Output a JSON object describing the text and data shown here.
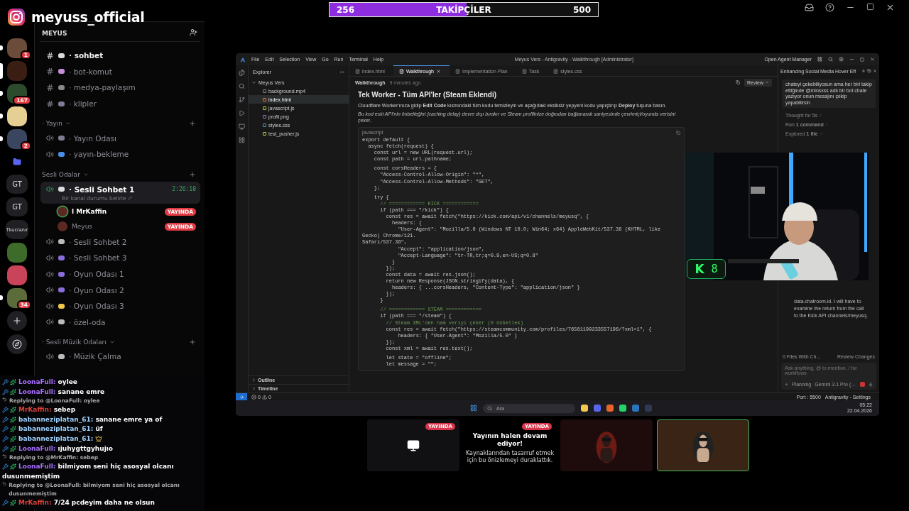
{
  "channel_banner": {
    "handle": "meyuss_official"
  },
  "follower_goal": {
    "current": "256",
    "label": "TAKİPÇİLER",
    "target": "500",
    "level": 0.51
  },
  "discord": {
    "server": "MEYUS",
    "servers": [
      {
        "kind": "picture",
        "selected": false,
        "unread": true,
        "badge": "1"
      },
      {
        "kind": "picture",
        "selected": true
      },
      {
        "kind": "picture",
        "selected": false,
        "unread": true,
        "badge": "167"
      },
      {
        "kind": "picture",
        "selected": false,
        "unread": true
      },
      {
        "kind": "picture",
        "selected": false,
        "unread": true,
        "badge": "2"
      },
      {
        "kind": "folder",
        "selected": false,
        "unread": false
      },
      {
        "kind": "label",
        "label": "GT",
        "selected": false,
        "unread": false
      },
      {
        "kind": "label",
        "label": "GT",
        "selected": false,
        "unread": false
      },
      {
        "kind": "label",
        "label": "Tkucranır",
        "selected": false,
        "unread": false
      },
      {
        "kind": "picture",
        "selected": false,
        "unread": false
      },
      {
        "kind": "picture",
        "selected": false,
        "unread": false
      },
      {
        "kind": "picture",
        "selected": false,
        "unread": true,
        "badge": "34"
      }
    ],
    "channels": [
      {
        "kind": "text",
        "name": "· sohbet",
        "unread": true
      },
      {
        "kind": "text",
        "name": "· bot-komut",
        "unread": false
      },
      {
        "kind": "text",
        "name": "· medya-paylaşım",
        "unread": false
      },
      {
        "kind": "text",
        "name": "· klipler",
        "unread": false
      },
      {
        "kind": "category",
        "name": "· Yayın"
      },
      {
        "kind": "voice",
        "name": "· Yayın Odası",
        "selected": false
      },
      {
        "kind": "voice",
        "name": "· yayın-bekleme",
        "selected": false
      },
      {
        "kind": "category",
        "name": "Sesli Odalar"
      },
      {
        "kind": "voice",
        "name": "· Sesli Sohbet 1",
        "selected": true,
        "timer": "2:26:10",
        "status": "Bir kanal durumu belirle"
      },
      {
        "kind": "user",
        "name": "l MrKaffin",
        "badge": "YAYINDA",
        "speaking": true
      },
      {
        "kind": "user",
        "name": "Meyus",
        "badge": "YAYINDA",
        "speaking": false
      },
      {
        "kind": "voice",
        "name": "· Sesli Sohbet 2",
        "selected": false
      },
      {
        "kind": "voice",
        "name": "· Sesli Sohbet 3",
        "selected": false
      },
      {
        "kind": "voice",
        "name": "· Oyun Odası 1",
        "selected": false
      },
      {
        "kind": "voice",
        "name": "· Oyun Odası 2",
        "selected": false
      },
      {
        "kind": "voice",
        "name": "· Oyun Odası 3",
        "selected": false
      },
      {
        "kind": "voice",
        "name": "· özel-oda",
        "selected": false
      },
      {
        "kind": "category",
        "name": "· Sesli Müzik Odaları"
      },
      {
        "kind": "voice",
        "name": "· Müzik Çalma",
        "selected": false
      }
    ]
  },
  "chat": [
    {
      "kind": "message",
      "user": "LoonaFull:",
      "color": "#a970ff",
      "text": "oylee"
    },
    {
      "kind": "message",
      "user": "LoonaFull:",
      "color": "#a970ff",
      "text": "sanane emre"
    },
    {
      "kind": "reply",
      "text": "Replying to @LoonaFull: oylee"
    },
    {
      "kind": "message",
      "user": "MrKaffin:",
      "color": "#e0403a",
      "text": "sebep"
    },
    {
      "kind": "message",
      "user": "babanneziplatan_61:",
      "color": "#9fd3ff",
      "text": "sanane emre ya of"
    },
    {
      "kind": "message",
      "user": "babanneziplatan_61:",
      "color": "#9fd3ff",
      "text": "üf"
    },
    {
      "kind": "emote",
      "user": "babanneziplatan_61:",
      "color": "#9fd3ff"
    },
    {
      "kind": "message",
      "user": "LoonaFull:",
      "color": "#a970ff",
      "text": "ıjuhygttgyhujıo"
    },
    {
      "kind": "reply",
      "text": "Replying to @MrKaffin: sebep"
    },
    {
      "kind": "message",
      "user": "LoonaFull:",
      "color": "#a970ff",
      "text": "bilmiyom seni hiç asosyal olcanı dusunmemiştim"
    },
    {
      "kind": "reply",
      "text": "Replying to @LoonaFull: bilmiyom seni hiç asosyal olcanı dusunmemiştim"
    },
    {
      "kind": "message",
      "user": "MrKaffin:",
      "color": "#e0403a",
      "text": "7/24 pcdeyim daha ne olsun"
    }
  ],
  "ide": {
    "menu": [
      "File",
      "Edit",
      "Selection",
      "View",
      "Go",
      "Run",
      "Terminal",
      "Help"
    ],
    "title": "Meyus Vers - Antigravity - Walkthrough [Administrator]",
    "agent_manager": "Open Agent Manager",
    "explorer": {
      "title": "Explorer",
      "folder": "Meyus Vers",
      "files": [
        {
          "name": "background.mp4",
          "selected": false
        },
        {
          "name": "index.html",
          "selected": true
        },
        {
          "name": "javascript.js",
          "selected": false
        },
        {
          "name": "profil.png",
          "selected": false
        },
        {
          "name": "styles.css",
          "selected": false
        },
        {
          "name": "test_pusher.js",
          "selected": false
        }
      ],
      "sections": [
        "Outline",
        "Timeline"
      ]
    },
    "tabs": [
      {
        "label": "index.html",
        "selected": false
      },
      {
        "label": "Walkthrough",
        "selected": true
      },
      {
        "label": "Implementation Plan",
        "selected": false
      },
      {
        "label": "Task",
        "selected": false
      },
      {
        "label": "styles.css",
        "selected": false
      }
    ],
    "breadcrumb": "Walkthrough",
    "edited": "9 minutes ago",
    "review": "Review",
    "doc": {
      "heading": "Tek Worker - Tüm API'ler (Steam Eklendi)",
      "paragraph": "Cloudflare Worker'ınıza gidip **Edit Code** kısmındaki tüm kodu temizleyin ve aşağıdaki eksiksiz yepyeni kodu yapıştırıp **Deploy** tuşuna basın.",
      "note": "Bu kod eski API'nin önbelleğini (caching delay) devre dışı bırakır ve Steam profilinize doğrudan bağlanarak saniyesinde çevrimiçi/oyunda verisini çeker.",
      "language": "javascript",
      "code": [
        {
          "kind": "code",
          "text": "export default {"
        },
        {
          "kind": "code",
          "text": "  async fetch(request) {"
        },
        {
          "kind": "code",
          "text": "    const url = new URL(request.url);"
        },
        {
          "kind": "code",
          "text": "    const path = url.pathname;"
        },
        {
          "kind": "code",
          "text": "    const corsHeaders = {",
          "space_before": true
        },
        {
          "kind": "code",
          "text": "      \"Access-Control-Allow-Origin\": \"*\","
        },
        {
          "kind": "code",
          "text": "      \"Access-Control-Allow-Methods\": \"GET\","
        },
        {
          "kind": "code",
          "text": "    };"
        },
        {
          "kind": "code",
          "text": "    try {",
          "space_before": true
        },
        {
          "kind": "comment",
          "text": "      // ============ KICK ============"
        },
        {
          "kind": "code",
          "text": "      if (path === \"/kick\") {"
        },
        {
          "kind": "code",
          "text": "        const res = await fetch(\"https://kick.com/api/v1/channels/meyusq\", {"
        },
        {
          "kind": "code",
          "text": "          headers: {"
        },
        {
          "kind": "code",
          "text": "            \"User-Agent\": \"Mozilla/5.0 (Windows NT 10.0; Win64; x64) AppleWebKit/537.36 (KHTML, like Gecko) Chrome/121."
        },
        {
          "kind": "code",
          "text": "Safari/537.36\","
        },
        {
          "kind": "code",
          "text": "            \"Accept\": \"application/json\","
        },
        {
          "kind": "code",
          "text": "            \"Accept-Language\": \"tr-TR,tr;q=0.9,en-US;q=0.8\""
        },
        {
          "kind": "code",
          "text": "          }"
        },
        {
          "kind": "code",
          "text": "        });"
        },
        {
          "kind": "code",
          "text": "        const data = await res.json();"
        },
        {
          "kind": "code",
          "text": "        return new Response(JSON.stringify(data), {"
        },
        {
          "kind": "code",
          "text": "          headers: { ...corsHeaders, \"Content-Type\": \"application/json\" }"
        },
        {
          "kind": "code",
          "text": "        });"
        },
        {
          "kind": "code",
          "text": "      }"
        },
        {
          "kind": "comment",
          "text": "      // ============ STEAM ============",
          "space_before": true
        },
        {
          "kind": "code",
          "text": "      if (path === \"/steam\") {"
        },
        {
          "kind": "comment",
          "text": "        // Steam XML'den ham veriyi çeker (0 önbellek)"
        },
        {
          "kind": "code",
          "text": "        const res = await fetch(\"https://steamcommunity.com/profiles/76561199233557196/?xml=1\", {"
        },
        {
          "kind": "code",
          "text": "            headers: { \"User-Agent\": \"Mozilla/5.0\" }"
        },
        {
          "kind": "code",
          "text": "        });"
        },
        {
          "kind": "code",
          "text": "        const xml = await res.text();"
        },
        {
          "kind": "code",
          "text": "        let state = \"offline\";",
          "space_before": true
        },
        {
          "kind": "code",
          "text": "        let message = \"\";"
        }
      ]
    },
    "agent": {
      "title": "Enhancing Social Media Hover Eff",
      "user_message": "chateyi çekebiliyosun ama her biri takip ettiğinde @minsxss adlı bir bot chate yazıyor onun mesajını çekip yapabilirsin",
      "steps": [
        "Thought for 5s",
        "Ran **1 command**",
        "Explored **1 file**"
      ],
      "reply": "data.chatroom.id. I will have to examine the return from the call to the Kick API channels/meyusq.",
      "files": "0 Files With Ch...",
      "review_changes": "Review Changes",
      "prompt": {
        "placeholder": "Ask anything, @ to mention, / for workflows"
      },
      "mode": "Planning",
      "model": "Gemini 3.1 Pro (..."
    },
    "status": {
      "errors": "0",
      "warnings": "0",
      "port": "Port : 5500",
      "settings": "Antigravity - Settings"
    },
    "taskbar": {
      "search": "Ara",
      "time": "05:22",
      "date": "22.04.2026"
    }
  },
  "webcam": {
    "kind": "picture",
    "logo": "K",
    "count": "8"
  },
  "previews": [
    {
      "kind": "screen",
      "badge": "YAYINDA",
      "selected": false
    },
    {
      "kind": "paused",
      "badge": "YAYINDA",
      "title": "Yayının halen devam ediyor!",
      "text": "Kaynaklarından tasarruf etmek için bu önizlemeyi duraklattık.",
      "selected": false
    },
    {
      "kind": "picture",
      "selected": false
    },
    {
      "kind": "picture",
      "selected": true
    }
  ]
}
